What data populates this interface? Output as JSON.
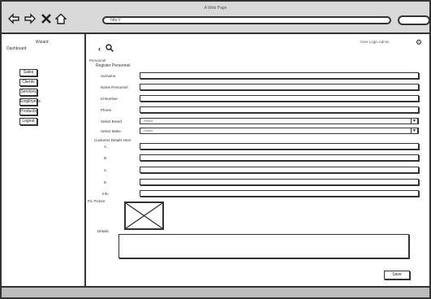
{
  "window": {
    "title": "A Web Page"
  },
  "toolbar": {
    "address": "http://",
    "icons": [
      "back-arrow-icon",
      "forward-arrow-icon",
      "close-icon",
      "home-icon"
    ]
  },
  "sidebar": {
    "title": "Wizard",
    "subtitle": "Dashboard",
    "items": [
      {
        "label": "Sales"
      },
      {
        "label": "Clients"
      },
      {
        "label": "Services"
      },
      {
        "label": "Employees"
      },
      {
        "label": "Products"
      },
      {
        "label": "Logout"
      }
    ]
  },
  "header": {
    "back_icon": "‹",
    "user_info": "User Login   Admin",
    "gear": "⚙"
  },
  "form": {
    "breadcrumb": "Personnel",
    "title": "Register Personnel",
    "fields": [
      {
        "label": "Surname",
        "value": ""
      },
      {
        "label": "Name Personnel",
        "value": ""
      },
      {
        "label": "Id Number",
        "value": ""
      },
      {
        "label": "Phone",
        "value": ""
      }
    ],
    "selects": [
      {
        "label": "Select Brand",
        "value": "Select"
      },
      {
        "label": "Select Make",
        "value": "Select"
      }
    ],
    "section_title": "Customer Details Here",
    "detail_fields": [
      {
        "label": "A",
        "value": ""
      },
      {
        "label": "B",
        "value": ""
      },
      {
        "label": "C",
        "value": ""
      },
      {
        "label": "D",
        "value": ""
      },
      {
        "label": "Info",
        "value": ""
      }
    ],
    "picture_label": "Pic Picture",
    "notes_label": "Details",
    "notes_value": "",
    "save_label": "Save"
  }
}
